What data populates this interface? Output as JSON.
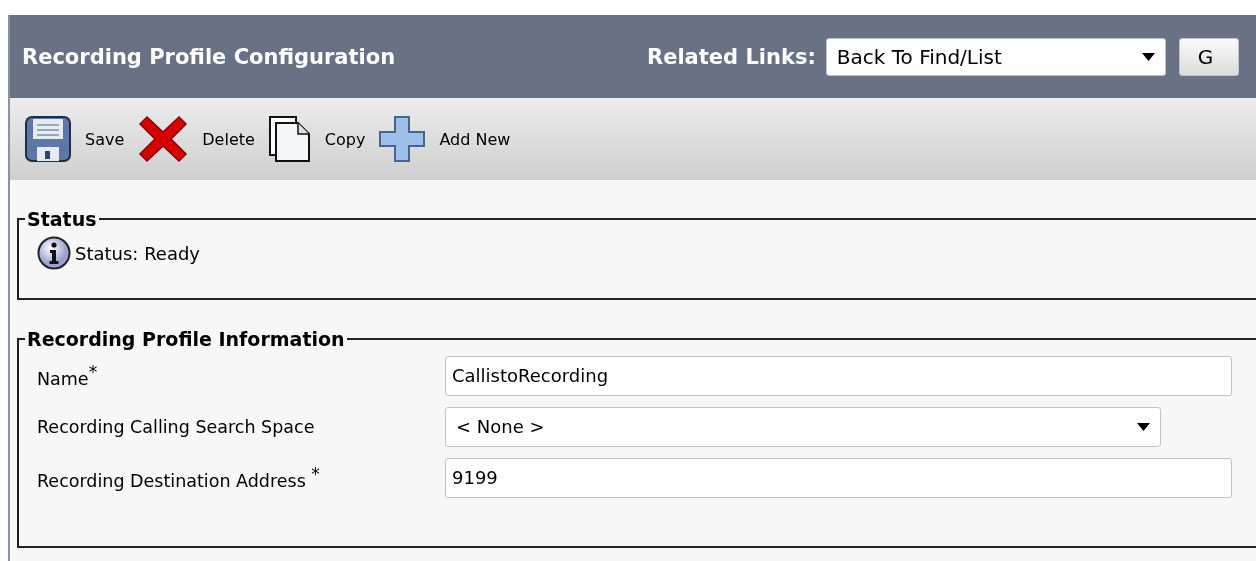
{
  "header": {
    "title": "Recording Profile Configuration",
    "related_links": {
      "label": "Related Links:",
      "value": "Back To Find/List"
    },
    "go_button": "G"
  },
  "toolbar": [
    {
      "kind": "save",
      "label": "Save"
    },
    {
      "kind": "delete",
      "label": "Delete"
    },
    {
      "kind": "copy",
      "label": "Copy"
    },
    {
      "kind": "add",
      "label": "Add New"
    }
  ],
  "status": {
    "legend": "Status",
    "message": "Status: Ready"
  },
  "info": {
    "legend": "Recording Profile Information",
    "fields": [
      {
        "kind": "text",
        "label": "Name$^{*}$",
        "value": "CallistoRecording"
      },
      {
        "kind": "select",
        "label": "Recording Calling Search Space",
        "value": "< None >"
      },
      {
        "kind": "text",
        "label": "Recording Destination Address $^{*}$",
        "value": "9199"
      }
    ]
  }
}
